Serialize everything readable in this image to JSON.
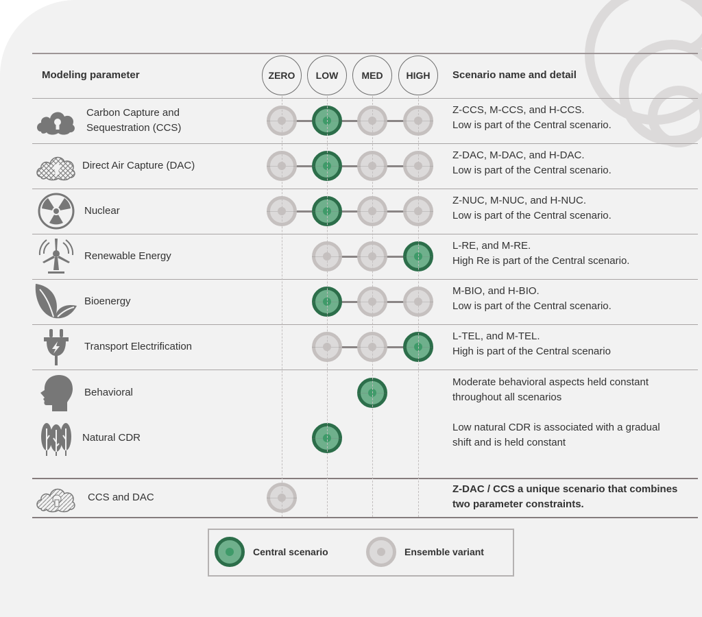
{
  "header": {
    "parameter_label": "Modeling parameter",
    "detail_label": "Scenario name and detail",
    "columns": [
      "ZERO",
      "LOW",
      "MED",
      "HIGH"
    ]
  },
  "rows": [
    {
      "label_lines": [
        "Carbon Capture and",
        "Sequestration (CCS)"
      ],
      "icon": "cloud-keyhole-icon",
      "levels": [
        "ensemble",
        "central",
        "ensemble",
        "ensemble"
      ],
      "detail": [
        "Z-CCS, M-CCS, and H-CCS.",
        "Low is part of the Central scenario."
      ]
    },
    {
      "label_lines": [
        "Direct Air Capture (DAC)"
      ],
      "icon": "mesh-cloud-keyhole-icon",
      "levels": [
        "ensemble",
        "central",
        "ensemble",
        "ensemble"
      ],
      "detail": [
        "Z-DAC, M-DAC, and H-DAC.",
        "Low is part of the Central scenario."
      ]
    },
    {
      "label_lines": [
        "Nuclear"
      ],
      "icon": "radiation-icon",
      "levels": [
        "ensemble",
        "central",
        "ensemble",
        "ensemble"
      ],
      "detail": [
        "Z-NUC, M-NUC, and H-NUC.",
        "Low is part of the Central scenario."
      ]
    },
    {
      "label_lines": [
        "Renewable Energy"
      ],
      "icon": "wind-turbine-icon",
      "levels": [
        null,
        "ensemble",
        "ensemble",
        "central"
      ],
      "detail": [
        "L-RE, and M-RE.",
        "High Re is part of the Central scenario."
      ]
    },
    {
      "label_lines": [
        "Bioenergy"
      ],
      "icon": "leaves-icon",
      "levels": [
        null,
        "central",
        "ensemble",
        "ensemble"
      ],
      "detail": [
        "M-BIO, and H-BIO.",
        "Low is part of the Central scenario."
      ]
    },
    {
      "label_lines": [
        "Transport Electrification"
      ],
      "icon": "electric-plug-icon",
      "levels": [
        null,
        "ensemble",
        "ensemble",
        "central"
      ],
      "detail": [
        "L-TEL, and M-TEL.",
        "High is part of the Central scenario"
      ]
    },
    {
      "label_lines": [
        "Behavioral"
      ],
      "icon": "human-head-icon",
      "levels": [
        null,
        null,
        "central",
        null
      ],
      "detail": [
        "Moderate behavioral aspects held constant",
        "throughout all scenarios"
      ]
    },
    {
      "label_lines": [
        "Natural CDR"
      ],
      "icon": "trees-icon",
      "levels": [
        null,
        "central",
        null,
        null
      ],
      "detail": [
        "Low natural CDR is associated with a gradual",
        "shift and is held constant"
      ]
    }
  ],
  "combined_row": {
    "label_lines": [
      "CCS and DAC"
    ],
    "icon": "hatched-cloud-keyhole-icon",
    "levels": [
      "ensemble",
      null,
      null,
      null
    ],
    "detail": [
      "Z-DAC / CCS a unique scenario that combines",
      "two parameter constraints."
    ]
  },
  "legend": {
    "central_label": "Central scenario",
    "ensemble_label": "Ensemble variant"
  },
  "colors": {
    "central_fill": "#6fb08c",
    "central_ring": "#2c6e4a",
    "ensemble_fill": "#dcdada",
    "ensemble_ring": "#c5c0bf",
    "background": "#f2f2f2"
  }
}
